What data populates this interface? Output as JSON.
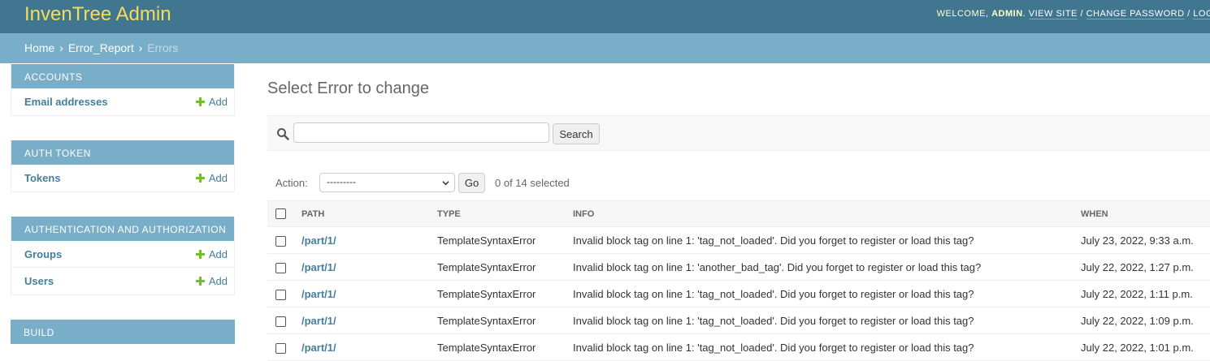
{
  "header": {
    "brand": "InvenTree Admin",
    "welcome": "WELCOME,",
    "user": "ADMIN",
    "view_site": "VIEW SITE",
    "change_password": "CHANGE PASSWORD",
    "logout": "LOG",
    "separator": "/"
  },
  "breadcrumbs": {
    "home": "Home",
    "app": "Error_Report",
    "current": "Errors",
    "arrow": "›"
  },
  "sidebar": {
    "add_label": "Add",
    "modules": [
      {
        "caption": "Accounts",
        "models": [
          "Email addresses"
        ]
      },
      {
        "caption": "Auth Token",
        "models": [
          "Tokens"
        ]
      },
      {
        "caption": "Authentication and Authorization",
        "models": [
          "Groups",
          "Users"
        ]
      },
      {
        "caption": "Build",
        "models": []
      }
    ]
  },
  "main": {
    "title": "Select Error to change",
    "search_button": "Search",
    "search_value": "",
    "action_label": "Action:",
    "action_selected": "---------",
    "go_button": "Go",
    "selected_count": "0 of 14 selected"
  },
  "table": {
    "headers": [
      "Path",
      "Type",
      "Info",
      "When"
    ],
    "rows": [
      {
        "path": "/part/1/",
        "type": "TemplateSyntaxError",
        "info": "Invalid block tag on line 1: 'tag_not_loaded'. Did you forget to register or load this tag?",
        "when": "July 23, 2022, 9:33 a.m."
      },
      {
        "path": "/part/1/",
        "type": "TemplateSyntaxError",
        "info": "Invalid block tag on line 1: 'another_bad_tag'. Did you forget to register or load this tag?",
        "when": "July 22, 2022, 1:27 p.m."
      },
      {
        "path": "/part/1/",
        "type": "TemplateSyntaxError",
        "info": "Invalid block tag on line 1: 'tag_not_loaded'. Did you forget to register or load this tag?",
        "when": "July 22, 2022, 1:11 p.m."
      },
      {
        "path": "/part/1/",
        "type": "TemplateSyntaxError",
        "info": "Invalid block tag on line 1: 'tag_not_loaded'. Did you forget to register or load this tag?",
        "when": "July 22, 2022, 1:09 p.m."
      },
      {
        "path": "/part/1/",
        "type": "TemplateSyntaxError",
        "info": "Invalid block tag on line 1: 'tag_not_loaded'. Did you forget to register or load this tag?",
        "when": "July 22, 2022, 1:01 p.m."
      }
    ]
  },
  "colors": {
    "header_bg": "#417690",
    "brand": "#f5dd5d",
    "breadcrumb_bg": "#79aec8",
    "link": "#447e9b",
    "add_icon": "#70bf2b"
  },
  "icons": {
    "search": "search-icon",
    "add": "plus-icon",
    "select": "chevron-down-icon"
  }
}
